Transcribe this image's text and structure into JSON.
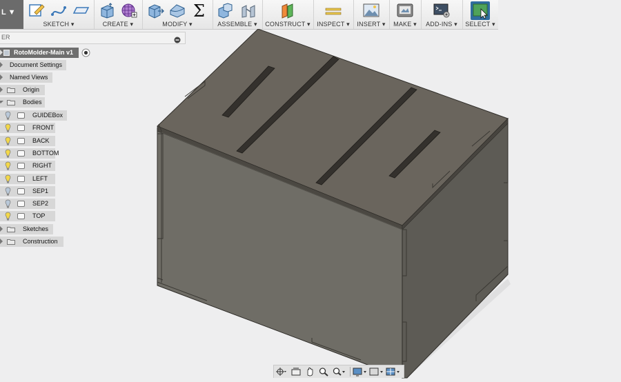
{
  "toolbar": {
    "workspace_label": "L ▼",
    "groups": {
      "sketch": "SKETCH ▾",
      "create": "CREATE ▾",
      "modify": "MODIFY ▾",
      "assemble": "ASSEMBLE ▾",
      "construct": "CONSTRUCT ▾",
      "inspect": "INSPECT ▾",
      "insert": "INSERT ▾",
      "make": "MAKE ▾",
      "addins": "ADD-INS ▾",
      "select": "SELECT ▾"
    }
  },
  "browser": {
    "header_label": "ER",
    "root": "RotoMolder-Main v1",
    "items": {
      "document_settings": "Document Settings",
      "named_views": "Named Views",
      "origin": "Origin",
      "bodies": "Bodies",
      "sketches": "Sketches",
      "construction": "Construction"
    },
    "bodies": [
      {
        "name": "GUIDEBox",
        "visible": false
      },
      {
        "name": "FRONT",
        "visible": true
      },
      {
        "name": "BACK",
        "visible": true
      },
      {
        "name": "BOTTOM",
        "visible": true
      },
      {
        "name": "RIGHT",
        "visible": true
      },
      {
        "name": "LEFT",
        "visible": true
      },
      {
        "name": "SEP1",
        "visible": false
      },
      {
        "name": "SEP2",
        "visible": false
      },
      {
        "name": "TOP",
        "visible": true
      }
    ]
  },
  "colors": {
    "body_top": "#69645c",
    "body_front": "#6e6c64",
    "body_right": "#5c5a54",
    "edge": "#2e2c28",
    "bulb_on": "#f2d74a",
    "bulb_off": "#b9c8d8",
    "select_accent": "#2f6d9e"
  }
}
